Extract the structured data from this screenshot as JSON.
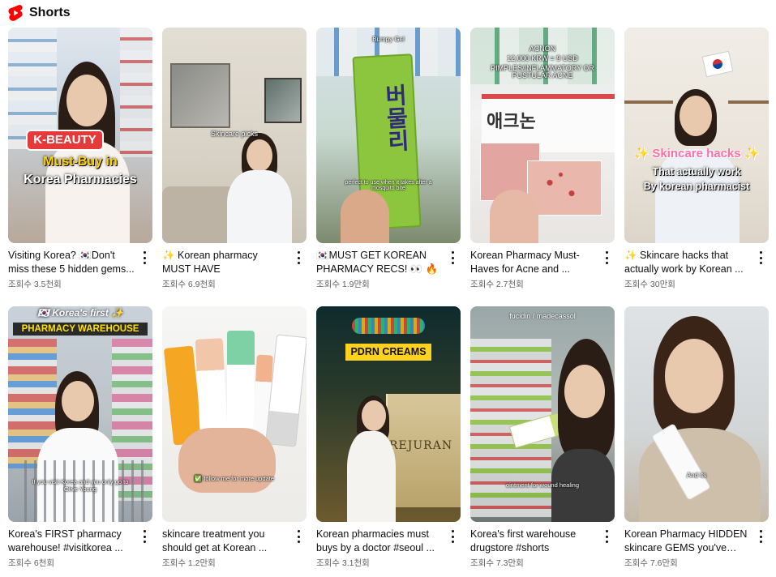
{
  "section": {
    "title": "Shorts",
    "icon": "youtube-shorts-icon",
    "accent": "#ff0000"
  },
  "videos": [
    {
      "title": "Visiting Korea? 🇰🇷Don't miss these 5 hidden gems...",
      "views": "조회수 3.5천회",
      "overlay1": "K-BEAUTY",
      "overlay2": "Must-Buy in",
      "overlay3": "Korea Pharmacies"
    },
    {
      "title": "✨ Korean pharmacy MUST HAVE",
      "views": "조회수 6.9천회",
      "caption": "Skincare picks"
    },
    {
      "title": "🇰🇷MUST GET KOREAN PHARMACY RECS! 👀 🔥",
      "views": "조회수 1.9만회",
      "caption_top": "Bumpy Gel",
      "product": "버물리",
      "caption": "perfect to use when it takes after a mosquito bite"
    },
    {
      "title": "Korean Pharmacy Must-Haves for Acne and ...",
      "views": "조회수 2.7천회",
      "overlay1": "ACNON",
      "overlay2": "12,000 KRW = 9 USD",
      "overlay3": "PIMPLES/INFLAMMATORY OR PUSTULAR ACNE",
      "product": "애크논"
    },
    {
      "title": "✨ Skincare hacks that actually work by Korean ...",
      "views": "조회수 30만회",
      "overlay1": "✨ Skincare hacks ✨",
      "overlay2": "That actually work",
      "overlay3": "By korean pharmacist"
    },
    {
      "title": "Korea's FIRST pharmacy warehouse! #visitkorea ...",
      "views": "조회수 6천회",
      "overlay1": "🇰🇷 Korea's first ✨",
      "overlay2": "PHARMACY WAREHOUSE",
      "caption": "If you visit Korea and you only go to Olive Young"
    },
    {
      "title": "skincare treatment you should get at Korean ...",
      "views": "조회수 1.2만회",
      "caption": "✅ follow me for more update"
    },
    {
      "title": "Korean pharmacies must buys by a doctor #seoul ...",
      "views": "조회수 3.1천회",
      "overlay1": "PDRN CREAMS",
      "product": "REJURAN"
    },
    {
      "title": "Korea's first warehouse drugstore #shorts",
      "views": "조회수 7.3만회",
      "overlay1": "fucidin / madecassol",
      "caption": "ointment for wound healing"
    },
    {
      "title": "Korean Pharmacy HIDDEN skincare GEMS you've nev...",
      "views": "조회수 7.6만회",
      "caption": "And its"
    }
  ]
}
